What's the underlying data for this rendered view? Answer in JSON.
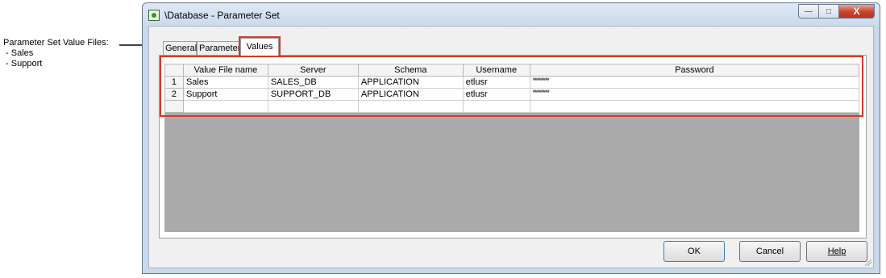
{
  "annotation": {
    "heading": "Parameter Set Value Files:",
    "items": [
      " - Sales",
      " - Support"
    ]
  },
  "window": {
    "title": "\\Database - Parameter Set",
    "controls": {
      "minimize": "—",
      "maximize": "□",
      "close": "X"
    }
  },
  "tabs": [
    {
      "label": "General",
      "mnemonic": "G"
    },
    {
      "label": "Parameters",
      "mnemonic": "P"
    },
    {
      "label": "Values",
      "mnemonic": "V",
      "active": true
    }
  ],
  "grid": {
    "columns": [
      "Value File name",
      "Server",
      "Schema",
      "Username",
      "Password"
    ],
    "rows": [
      {
        "num": "1",
        "name": "Sales",
        "server": "SALES_DB",
        "schema": "APPLICATION",
        "user": "etlusr",
        "password": "********"
      },
      {
        "num": "2",
        "name": "Support",
        "server": "SUPPORT_DB",
        "schema": "APPLICATION",
        "user": "etlusr",
        "password": "********"
      }
    ]
  },
  "buttons": {
    "ok": "OK",
    "cancel": "Cancel",
    "help": "Help"
  },
  "colors": {
    "highlight": "#d9382a",
    "grid_background": "#ababab"
  }
}
